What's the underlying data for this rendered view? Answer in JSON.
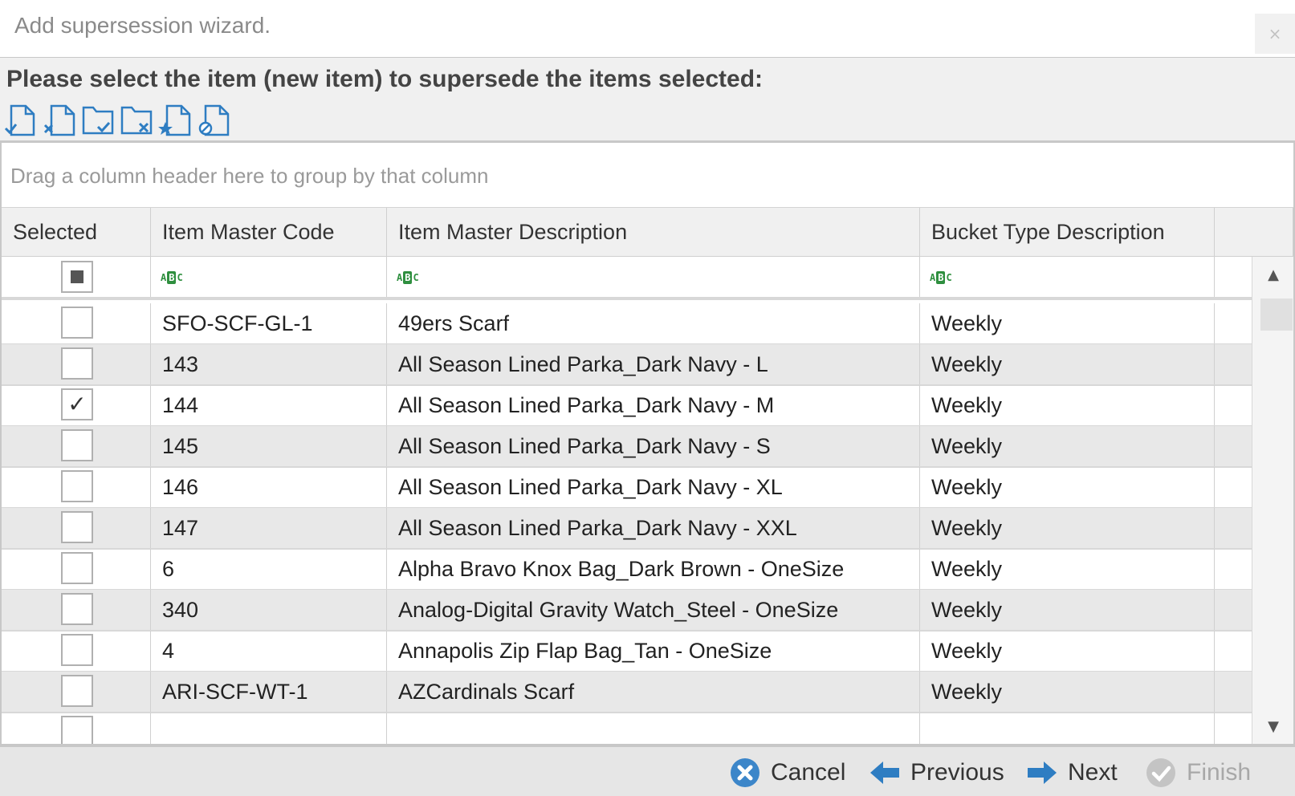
{
  "window": {
    "title": "Add supersession wizard.",
    "close_label": "×"
  },
  "instruction": "Please select the item (new item) to supersede the items selected:",
  "toolbar": [
    {
      "icon": "select-item-icon"
    },
    {
      "icon": "unselect-item-icon"
    },
    {
      "icon": "select-all-icon"
    },
    {
      "icon": "unselect-all-icon"
    },
    {
      "icon": "add-favorite-item-icon"
    },
    {
      "icon": "clear-selection-icon"
    }
  ],
  "grid": {
    "group_panel_text": "Drag a column header here to group by that column",
    "columns": [
      "Selected",
      "Item Master Code",
      "Item Master Description",
      "Bucket Type Description"
    ],
    "rows": [
      {
        "selected": "",
        "code": "SFO-SCF-GL-1",
        "description": "49ers Scarf",
        "bucket": "Weekly"
      },
      {
        "selected": "",
        "code": "143",
        "description": "All Season Lined Parka_Dark Navy - L",
        "bucket": "Weekly"
      },
      {
        "selected": "✓",
        "code": "144",
        "description": "All Season Lined Parka_Dark Navy - M",
        "bucket": "Weekly"
      },
      {
        "selected": "",
        "code": "145",
        "description": "All Season Lined Parka_Dark Navy - S",
        "bucket": "Weekly"
      },
      {
        "selected": "",
        "code": "146",
        "description": "All Season Lined Parka_Dark Navy - XL",
        "bucket": "Weekly"
      },
      {
        "selected": "",
        "code": "147",
        "description": "All Season Lined Parka_Dark Navy - XXL",
        "bucket": "Weekly"
      },
      {
        "selected": "",
        "code": "6",
        "description": "Alpha Bravo Knox Bag_Dark Brown - OneSize",
        "bucket": "Weekly"
      },
      {
        "selected": "",
        "code": "340",
        "description": "Analog-Digital Gravity Watch_Steel - OneSize",
        "bucket": "Weekly"
      },
      {
        "selected": "",
        "code": "4",
        "description": "Annapolis Zip Flap Bag_Tan - OneSize",
        "bucket": "Weekly"
      },
      {
        "selected": "",
        "code": "ARI-SCF-WT-1",
        "description": "AZCardinals Scarf",
        "bucket": "Weekly"
      }
    ]
  },
  "footer": {
    "cancel": "Cancel",
    "previous": "Previous",
    "next": "Next",
    "finish": "Finish"
  },
  "colors": {
    "accent": "#2e7dc2",
    "cancel": "#3c86c9",
    "filter_icon": "#2f8f3f",
    "alt_row": "#e8e8e8"
  }
}
